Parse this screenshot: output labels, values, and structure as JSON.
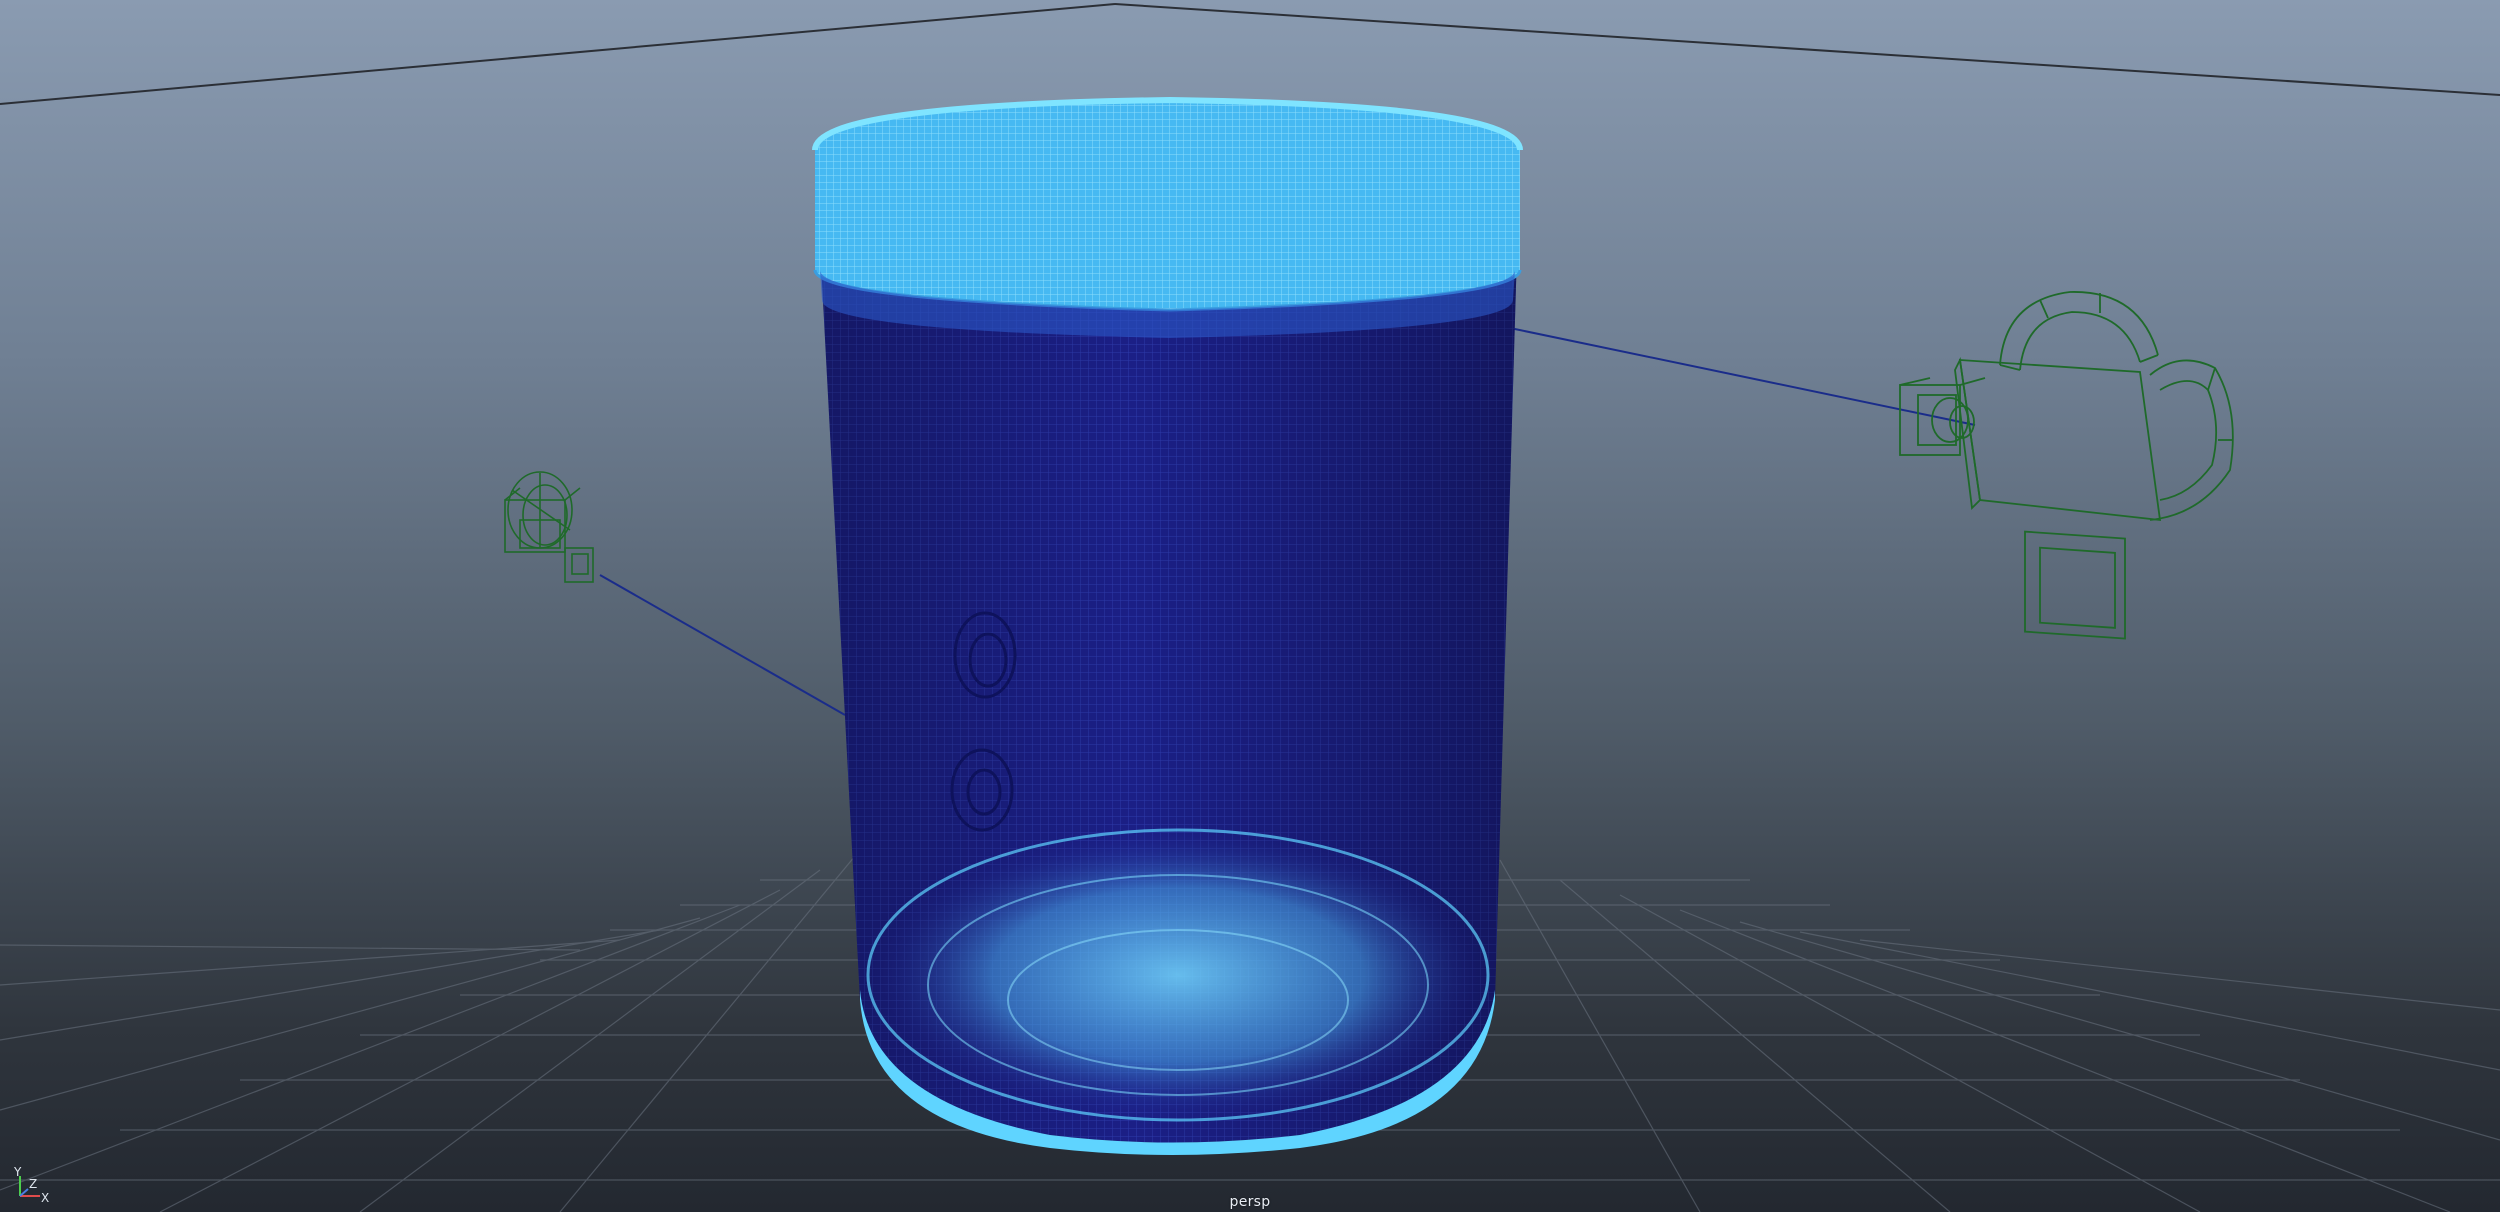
{
  "viewport": {
    "camera_name": "persp",
    "axes": {
      "x": "X",
      "y": "Y",
      "z": "Z"
    }
  },
  "colors": {
    "background_top": "#8a9bb1",
    "background_bottom": "#232830",
    "mesh_fill": "#1b1f86",
    "mesh_highlight": "#5fd4ff",
    "camera_wire": "#1f6a2a",
    "grid": "#6a7480",
    "camera_line": "#1a2c8a"
  },
  "icons": {
    "axis": "view-axis-icon",
    "camera_left": "camera-wireframe-icon",
    "camera_right": "camera-wireframe-icon"
  }
}
